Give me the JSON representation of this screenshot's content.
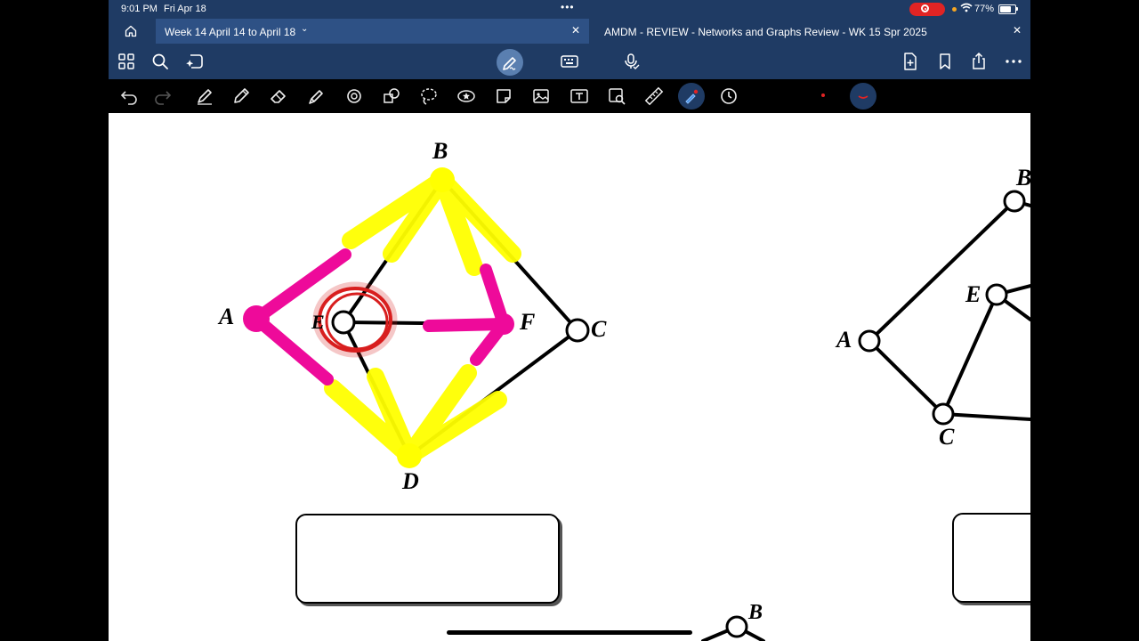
{
  "status": {
    "time": "9:01 PM",
    "date": "Fri Apr 18",
    "battery": "77%",
    "battery_level": 0.77
  },
  "tabs": [
    {
      "label": "Week 14 April 14 to April 18",
      "active": true
    },
    {
      "label": "AMDM - REVIEW - Networks and Graphs Review - WK 15 Spr 2025",
      "active": false
    }
  ],
  "toolbar": {
    "left_icons": [
      "grid-icon",
      "search-icon",
      "lasso-sparkle-icon"
    ],
    "center_icons": [
      "pen-scribble-icon",
      "keyboard-icon",
      "microphone-icon"
    ],
    "right_icons": [
      "add-page-icon",
      "bookmark-icon",
      "share-icon",
      "more-icon"
    ]
  },
  "tools": {
    "items": [
      "undo-icon",
      "redo-icon",
      "pen-icon",
      "pencil-icon",
      "eraser-icon",
      "highlighter-icon",
      "shapes-icon",
      "elements-icon",
      "lasso-icon",
      "sticker-icon",
      "sticky-note-icon",
      "image-icon",
      "text-box-icon",
      "scan-icon",
      "ruler-icon",
      "laser-icon",
      "timer-icon"
    ],
    "colors": {
      "red_dot": "#e02424",
      "navy": "#1f3b64"
    }
  },
  "graph1": {
    "labels": {
      "a": "A",
      "b": "B",
      "c": "C",
      "d": "D",
      "e": "E",
      "f": "F"
    }
  },
  "graph2": {
    "labels": {
      "a": "A",
      "b": "B",
      "c": "C",
      "e": "E"
    }
  },
  "graph3": {
    "labels": {
      "b": "B"
    }
  },
  "colors": {
    "yellow_highlight": "#ffff00",
    "magenta_highlight": "#ee0a9a",
    "red_circle": "#d81e1e"
  }
}
